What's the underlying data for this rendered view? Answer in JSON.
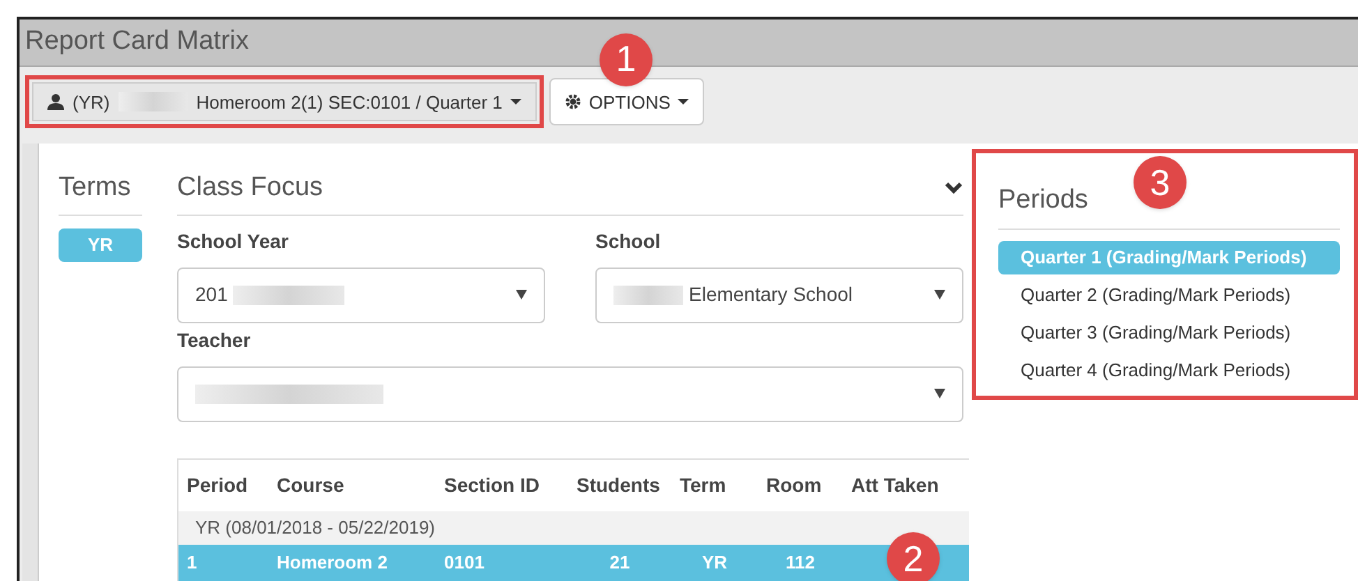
{
  "window": {
    "title": "Report Card Matrix"
  },
  "toolbar": {
    "class_selector": {
      "prefix": "(YR)",
      "value": "Homeroom 2(1) SEC:0101 / Quarter 1"
    },
    "options_button": {
      "label": "OPTIONS"
    }
  },
  "terms": {
    "heading": "Terms",
    "items": [
      {
        "label": "YR",
        "selected": true
      }
    ]
  },
  "class_focus": {
    "heading": "Class Focus",
    "expanded": true,
    "fields": [
      {
        "label": "School Year",
        "value": "201"
      },
      {
        "label": "School",
        "value": "Elementary School"
      },
      {
        "label": "Teacher"
      }
    ]
  },
  "table": {
    "columns": [
      "Period",
      "Course",
      "Section ID",
      "Students",
      "Term",
      "Room",
      "Att Taken"
    ],
    "groups": [
      {
        "label": "YR (08/01/2018 - 05/22/2019)",
        "rows": [
          {
            "selected": true,
            "cells": [
              "1",
              "Homeroom 2",
              "0101",
              "21",
              "YR",
              "112"
            ]
          }
        ]
      }
    ]
  },
  "periods": {
    "heading": "Periods",
    "items": [
      {
        "label": "Quarter 1 (Grading/Mark Periods)",
        "selected": true
      },
      {
        "label": "Quarter 2 (Grading/Mark Periods)",
        "selected": false
      },
      {
        "label": "Quarter 3 (Grading/Mark Periods)",
        "selected": false
      },
      {
        "label": "Quarter 4 (Grading/Mark Periods)",
        "selected": false
      }
    ]
  },
  "callouts": [
    {
      "label": "1"
    },
    {
      "label": "2"
    },
    {
      "label": "3"
    }
  ]
}
